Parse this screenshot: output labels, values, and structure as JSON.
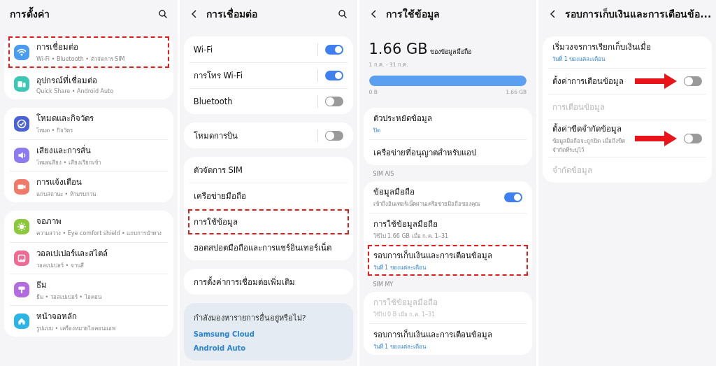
{
  "panels": [
    {
      "title": "การตั้งค่า",
      "back": false,
      "search": true,
      "blocks": [
        {
          "kind": "group",
          "rows": [
            {
              "kind": "nav",
              "title": "การเชื่อมต่อ",
              "subtitle": "Wi-Fi • Bluetooth • ตัวจัดการ SIM",
              "color": "#4a9cf0",
              "highlighted": true
            },
            {
              "kind": "nav",
              "title": "อุปกรณ์ที่เชื่อมต่อ",
              "subtitle": "Quick Share • Android Auto",
              "color": "#3cc7b4",
              "highlighted": false
            }
          ]
        },
        {
          "kind": "group",
          "rows": [
            {
              "kind": "nav",
              "title": "โหมดและกิจวัตร",
              "subtitle": "โหมด • กิจวัตร",
              "color": "#4a62d8",
              "highlighted": false
            },
            {
              "kind": "nav",
              "title": "เสียงและการสั่น",
              "subtitle": "โหมดเสียง • เสียงเรียกเข้า",
              "color": "#8c7cf0",
              "highlighted": false
            },
            {
              "kind": "nav",
              "title": "การแจ้งเตือน",
              "subtitle": "แถบสถานะ • ห้ามรบกวน",
              "color": "#f07a6a",
              "highlighted": false
            }
          ]
        },
        {
          "kind": "group",
          "rows": [
            {
              "kind": "nav",
              "title": "จอภาพ",
              "subtitle": "ความสว่าง • Eye comfort shield • แถบการนำทาง",
              "color": "#8cc83c",
              "highlighted": false
            },
            {
              "kind": "nav",
              "title": "วอลเปเปอร์และสไตล์",
              "subtitle": "วอลเปเปอร์ • จานสี",
              "color": "#ec6c94",
              "highlighted": false
            },
            {
              "kind": "nav",
              "title": "ธีม",
              "subtitle": "ธีม • วอลเปเปอร์ • ไอคอน",
              "color": "#b26ce0",
              "highlighted": false
            },
            {
              "kind": "nav",
              "title": "หน้าจอหลัก",
              "subtitle": "รูปแบบ • เครื่องหมายไอคอนแอพ",
              "color": "#2cb4e4",
              "highlighted": false
            }
          ]
        }
      ]
    },
    {
      "title": "การเชื่อมต่อ",
      "back": true,
      "search": true,
      "blocks": [
        {
          "kind": "group",
          "rows": [
            {
              "kind": "split_toggle",
              "title": "Wi-Fi",
              "on": true,
              "highlighted": false
            },
            {
              "kind": "split_toggle",
              "title": "การโทร Wi-Fi",
              "on": true,
              "highlighted": false
            },
            {
              "kind": "split_toggle",
              "title": "Bluetooth",
              "on": false,
              "highlighted": false
            }
          ]
        },
        {
          "kind": "group",
          "rows": [
            {
              "kind": "split_toggle",
              "title": "โหมดการบิน",
              "on": false,
              "highlighted": false
            }
          ]
        },
        {
          "kind": "group",
          "rows": [
            {
              "kind": "nav",
              "title": "ตัวจัดการ SIM",
              "highlighted": false
            },
            {
              "kind": "nav",
              "title": "เครือข่ายมือถือ",
              "highlighted": false
            },
            {
              "kind": "nav",
              "title": "การใช้ข้อมูล",
              "highlighted": true
            },
            {
              "kind": "nav",
              "title": "ฮอตสปอตมือถือและการแชร์อินเทอร์เน็ต",
              "highlighted": false
            }
          ]
        },
        {
          "kind": "group",
          "rows": [
            {
              "kind": "nav",
              "title": "การตั้งค่าการเชื่อมต่อเพิ่มเติม",
              "highlighted": false
            }
          ]
        },
        {
          "kind": "suggest",
          "question": "กำลังมองหารายการอื่นอยู่หรือไม่?",
          "links": [
            "Samsung Cloud",
            "Android Auto"
          ]
        }
      ]
    },
    {
      "title": "การใช้ข้อมูล",
      "back": true,
      "search": false,
      "blocks": [
        {
          "kind": "usage",
          "amount": "1.66 GB",
          "unit": "ของข้อมูลมือถือ",
          "period": "1 ก.ค. - 31 ก.ค.",
          "level": 1,
          "min": "0 B",
          "max": "1.66 GB"
        },
        {
          "kind": "group",
          "rows": [
            {
              "kind": "nav",
              "title": "ตัวประหยัดข้อมูล",
              "subtitle": "ปิด",
              "accent": true,
              "disabled": false,
              "highlighted": false
            },
            {
              "kind": "nav",
              "title": "เครือข่ายที่อนุญาตสำหรับแอป",
              "disabled": false,
              "highlighted": false
            }
          ]
        },
        {
          "kind": "label",
          "text": "SIM AIS"
        },
        {
          "kind": "group",
          "rows": [
            {
              "kind": "toggle",
              "title": "ข้อมูลมือถือ",
              "subtitle": "เข้าถึงอินเทอร์เน็ตผ่านเครือข่ายมือถือของคุณ",
              "accent": false,
              "on": true,
              "disabled": false,
              "highlighted": false
            },
            {
              "kind": "nav",
              "title": "การใช้ข้อมูลมือถือ",
              "subtitle": "ใช้ไป 1.66 GB เมื่อ ก.ค. 1–31",
              "accent": false,
              "disabled": false,
              "highlighted": false
            },
            {
              "kind": "nav",
              "title": "รอบการเก็บเงินและการเตือนข้อมูล",
              "subtitle": "วันที่ 1 ของแต่ละเดือน",
              "accent": true,
              "disabled": false,
              "highlighted": true
            }
          ]
        },
        {
          "kind": "label",
          "text": "SIM MY"
        },
        {
          "kind": "group",
          "rows": [
            {
              "kind": "nav",
              "title": "การใช้ข้อมูลมือถือ",
              "subtitle": "ใช้ไป 0 B เมื่อ ก.ค. 1–31",
              "accent": false,
              "disabled": true,
              "highlighted": false
            },
            {
              "kind": "nav",
              "title": "รอบการเก็บเงินและการเตือนข้อมูล",
              "subtitle": "วันที่ 1 ของแต่ละเดือน",
              "accent": true,
              "disabled": false,
              "highlighted": false
            }
          ]
        }
      ]
    },
    {
      "title": "รอบการเก็บเงินและการเตือนข้อ...",
      "back": true,
      "search": false,
      "blocks": [
        {
          "kind": "group",
          "rows": [
            {
              "kind": "nav",
              "title": "เริ่มวงจรการเรียกเก็บเงินเมื่อ",
              "subtitle": "วันที่ 1 ของแต่ละเดือน",
              "accent": true,
              "disabled": false,
              "highlighted": false,
              "arrow": false
            },
            {
              "kind": "toggle",
              "title": "ตั้งค่าการเตือนข้อมูล",
              "on": false,
              "disabled": false,
              "highlighted": false,
              "arrow": true
            },
            {
              "kind": "nav",
              "title": "การเตือนข้อมูล",
              "disabled": true,
              "highlighted": false,
              "arrow": false
            },
            {
              "kind": "toggle",
              "title": "ตั้งค่าขีดจำกัดข้อมูล",
              "subtitle": "ข้อมูลมือถือจะถูกปิด เมื่อถึงขีดจำกัดที่ระบุไว้",
              "accent": false,
              "on": false,
              "disabled": false,
              "highlighted": false,
              "arrow": true
            },
            {
              "kind": "nav",
              "title": "จำกัดข้อมูล",
              "disabled": true,
              "highlighted": false,
              "arrow": false
            }
          ]
        }
      ]
    }
  ]
}
